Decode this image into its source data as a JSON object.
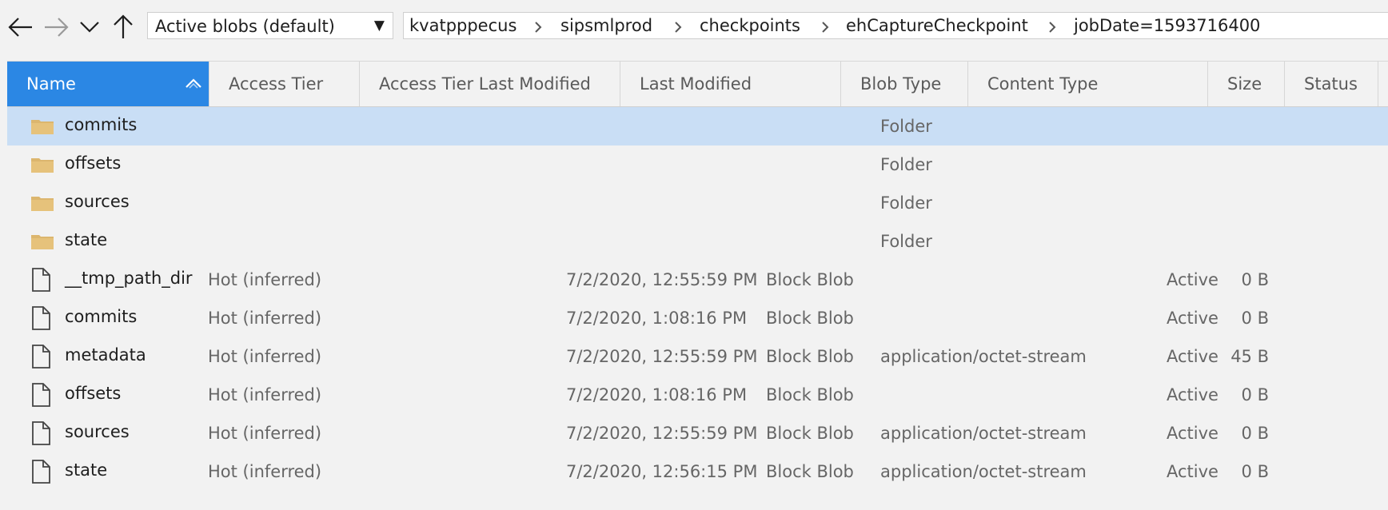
{
  "toolbar": {
    "back_icon": "arrow-left-icon",
    "forward_icon": "arrow-right-icon",
    "recent_icon": "chevron-down-icon",
    "up_icon": "arrow-up-icon",
    "filter_value": "Active blobs (default)",
    "filter_caret": "▼"
  },
  "breadcrumb": [
    "kvatpppecus",
    "sipsmlprod",
    "checkpoints",
    "ehCaptureCheckpoint",
    "jobDate=1593716400"
  ],
  "columns": {
    "name": "Name",
    "access_tier": "Access Tier",
    "access_tier_modified": "Access Tier Last Modified",
    "last_modified": "Last Modified",
    "blob_type": "Blob Type",
    "content_type": "Content Type",
    "size": "Size",
    "status": "Status"
  },
  "colors": {
    "accent": "#2b87e4",
    "selected_row": "#c9def5",
    "folder": "#dcb66e"
  },
  "rows": [
    {
      "icon": "folder-icon",
      "name": "commits",
      "access_tier": "",
      "access_tier_modified": "",
      "last_modified": "",
      "blob_type": "",
      "content_type": "Folder",
      "size": "",
      "status": ""
    },
    {
      "icon": "folder-icon",
      "name": "offsets",
      "access_tier": "",
      "access_tier_modified": "",
      "last_modified": "",
      "blob_type": "",
      "content_type": "Folder",
      "size": "",
      "status": ""
    },
    {
      "icon": "folder-icon",
      "name": "sources",
      "access_tier": "",
      "access_tier_modified": "",
      "last_modified": "",
      "blob_type": "",
      "content_type": "Folder",
      "size": "",
      "status": ""
    },
    {
      "icon": "folder-icon",
      "name": "state",
      "access_tier": "",
      "access_tier_modified": "",
      "last_modified": "",
      "blob_type": "",
      "content_type": "Folder",
      "size": "",
      "status": ""
    },
    {
      "icon": "file-icon",
      "name": "__tmp_path_dir",
      "access_tier": "Hot (inferred)",
      "access_tier_modified": "",
      "last_modified": "7/2/2020, 12:55:59 PM",
      "blob_type": "Block Blob",
      "content_type": "",
      "size": "0 B",
      "status": "Active"
    },
    {
      "icon": "file-icon",
      "name": "commits",
      "access_tier": "Hot (inferred)",
      "access_tier_modified": "",
      "last_modified": "7/2/2020, 1:08:16 PM",
      "blob_type": "Block Blob",
      "content_type": "",
      "size": "0 B",
      "status": "Active"
    },
    {
      "icon": "file-icon",
      "name": "metadata",
      "access_tier": "Hot (inferred)",
      "access_tier_modified": "",
      "last_modified": "7/2/2020, 12:55:59 PM",
      "blob_type": "Block Blob",
      "content_type": "application/octet-stream",
      "size": "45 B",
      "status": "Active"
    },
    {
      "icon": "file-icon",
      "name": "offsets",
      "access_tier": "Hot (inferred)",
      "access_tier_modified": "",
      "last_modified": "7/2/2020, 1:08:16 PM",
      "blob_type": "Block Blob",
      "content_type": "",
      "size": "0 B",
      "status": "Active"
    },
    {
      "icon": "file-icon",
      "name": "sources",
      "access_tier": "Hot (inferred)",
      "access_tier_modified": "",
      "last_modified": "7/2/2020, 12:55:59 PM",
      "blob_type": "Block Blob",
      "content_type": "application/octet-stream",
      "size": "0 B",
      "status": "Active"
    },
    {
      "icon": "file-icon",
      "name": "state",
      "access_tier": "Hot (inferred)",
      "access_tier_modified": "",
      "last_modified": "7/2/2020, 12:56:15 PM",
      "blob_type": "Block Blob",
      "content_type": "application/octet-stream",
      "size": "0 B",
      "status": "Active"
    }
  ],
  "selected_row": 0
}
